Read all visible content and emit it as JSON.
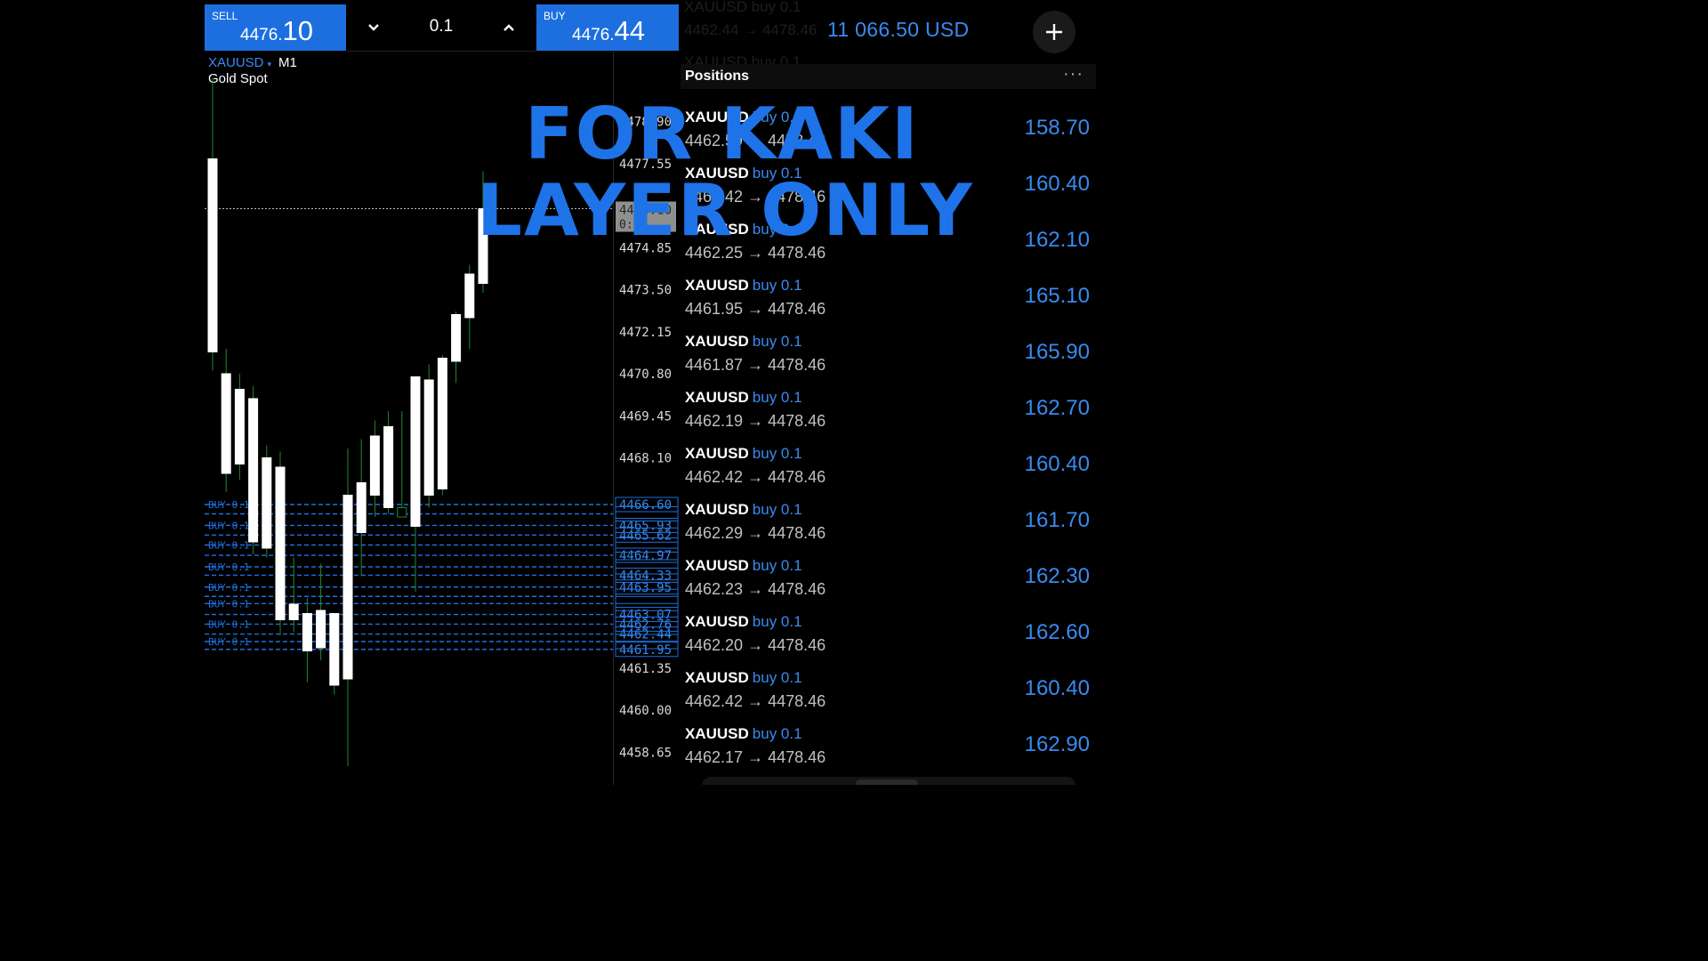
{
  "trade_bar": {
    "sell": {
      "label": "SELL",
      "price_small": "4476.",
      "price_large": "10"
    },
    "buy": {
      "label": "BUY",
      "price_small": "4476.",
      "price_large": "44"
    },
    "volume": "0.1",
    "volume_down_icon": "chevron-down-icon",
    "volume_up_icon": "chevron-up-icon"
  },
  "chart": {
    "symbol": "XAUUSD",
    "symbol_arrow": "▾",
    "timeframe": "M1",
    "description": "Gold Spot",
    "price_axis": [
      "4478.90",
      "4477.55",
      "4476.10",
      "4474.85",
      "4473.50",
      "4472.15",
      "4470.80",
      "4469.45",
      "4468.10",
      "4466.60",
      "4465.93",
      "4465.62",
      "4464.97",
      "4464.33",
      "4463.95",
      "4463.07",
      "4462.76",
      "4462.44",
      "4461.95",
      "4461.35",
      "4460.00",
      "4458.65"
    ],
    "current_price": "4476.10",
    "countdown": "0:15",
    "order_line_label": "BUY 0.1",
    "colors": {
      "bull": "#ffffff",
      "wick": "#1f8a2a",
      "order_lines": "#1d6fe0"
    }
  },
  "chart_data": {
    "type": "candlestick",
    "timeframe": "M1",
    "ylim": [
      4458.0,
      4480.0
    ],
    "candles": [
      {
        "open": 4471.5,
        "high": 4480.3,
        "low": 4470.9,
        "close": 4477.7
      },
      {
        "open": 4467.6,
        "high": 4471.6,
        "low": 4467.0,
        "close": 4470.8
      },
      {
        "open": 4467.9,
        "high": 4470.8,
        "low": 4467.4,
        "close": 4470.3
      },
      {
        "open": 4465.4,
        "high": 4470.4,
        "low": 4465.0,
        "close": 4470.0
      },
      {
        "open": 4465.2,
        "high": 4468.5,
        "low": 4464.9,
        "close": 4468.1
      },
      {
        "open": 4462.9,
        "high": 4468.3,
        "low": 4462.4,
        "close": 4467.8
      },
      {
        "open": 4462.9,
        "high": 4464.9,
        "low": 4462.5,
        "close": 4463.4
      },
      {
        "open": 4461.9,
        "high": 4463.6,
        "low": 4460.9,
        "close": 4463.1
      },
      {
        "open": 4462.0,
        "high": 4464.7,
        "low": 4461.6,
        "close": 4463.2
      },
      {
        "open": 4460.8,
        "high": 4463.0,
        "low": 4460.5,
        "close": 4463.1
      },
      {
        "open": 4461.0,
        "high": 4468.4,
        "low": 4458.2,
        "close": 4466.9
      },
      {
        "open": 4465.7,
        "high": 4468.7,
        "low": 4464.3,
        "close": 4467.3
      },
      {
        "open": 4466.9,
        "high": 4469.3,
        "low": 4466.2,
        "close": 4468.8
      },
      {
        "open": 4466.5,
        "high": 4469.6,
        "low": 4466.3,
        "close": 4469.1
      },
      {
        "open": 4466.5,
        "high": 4469.6,
        "low": 4466.3,
        "close": 4466.2
      },
      {
        "open": 4465.9,
        "high": 4470.2,
        "low": 4463.8,
        "close": 4470.7
      },
      {
        "open": 4466.9,
        "high": 4471.1,
        "low": 4466.5,
        "close": 4470.6
      },
      {
        "open": 4467.1,
        "high": 4471.4,
        "low": 4466.9,
        "close": 4471.3
      },
      {
        "open": 4471.2,
        "high": 4472.8,
        "low": 4470.5,
        "close": 4472.7
      },
      {
        "open": 4472.6,
        "high": 4474.3,
        "low": 4471.6,
        "close": 4474.0
      },
      {
        "open": 4473.7,
        "high": 4477.3,
        "low": 4473.4,
        "close": 4476.1
      }
    ],
    "order_levels": [
      4466.6,
      4466.3,
      4465.93,
      4465.62,
      4465.3,
      4464.97,
      4464.6,
      4464.33,
      4463.95,
      4463.65,
      4463.42,
      4463.07,
      4462.76,
      4462.44,
      4462.2,
      4461.95
    ]
  },
  "account": {
    "balance": "11 066.50 USD",
    "add_icon": "plus-icon",
    "ghost_rows": [
      "XAUUSD buy 0.1",
      "4462.44 → 4478.46",
      "XAUUSD buy 0.1",
      "4462.45 → 4478.46"
    ]
  },
  "positions": {
    "title": "Positions",
    "more_icon": "more-icon",
    "items": [
      {
        "symbol": "XAUUSD",
        "side": "buy 0.1",
        "open": "4462.59",
        "current": "4478.46",
        "profit": "158.70"
      },
      {
        "symbol": "XAUUSD",
        "side": "buy 0.1",
        "open": "4462.42",
        "current": "4478.46",
        "profit": "160.40"
      },
      {
        "symbol": "XAUUSD",
        "side": "buy 0.1",
        "open": "4462.25",
        "current": "4478.46",
        "profit": "162.10"
      },
      {
        "symbol": "XAUUSD",
        "side": "buy 0.1",
        "open": "4461.95",
        "current": "4478.46",
        "profit": "165.10"
      },
      {
        "symbol": "XAUUSD",
        "side": "buy 0.1",
        "open": "4461.87",
        "current": "4478.46",
        "profit": "165.90"
      },
      {
        "symbol": "XAUUSD",
        "side": "buy 0.1",
        "open": "4462.19",
        "current": "4478.46",
        "profit": "162.70"
      },
      {
        "symbol": "XAUUSD",
        "side": "buy 0.1",
        "open": "4462.42",
        "current": "4478.46",
        "profit": "160.40"
      },
      {
        "symbol": "XAUUSD",
        "side": "buy 0.1",
        "open": "4462.29",
        "current": "4478.46",
        "profit": "161.70"
      },
      {
        "symbol": "XAUUSD",
        "side": "buy 0.1",
        "open": "4462.23",
        "current": "4478.46",
        "profit": "162.30"
      },
      {
        "symbol": "XAUUSD",
        "side": "buy 0.1",
        "open": "4462.20",
        "current": "4478.46",
        "profit": "162.60"
      },
      {
        "symbol": "XAUUSD",
        "side": "buy 0.1",
        "open": "4462.42",
        "current": "4478.46",
        "profit": "160.40"
      },
      {
        "symbol": "XAUUSD",
        "side": "buy 0.1",
        "open": "4462.17",
        "current": "4478.46",
        "profit": "162.90"
      }
    ],
    "arrow": "→"
  },
  "overlay": {
    "line1": "FOR KAKI",
    "line2": "LAYER ONLY",
    "color": "#1f73e8"
  }
}
